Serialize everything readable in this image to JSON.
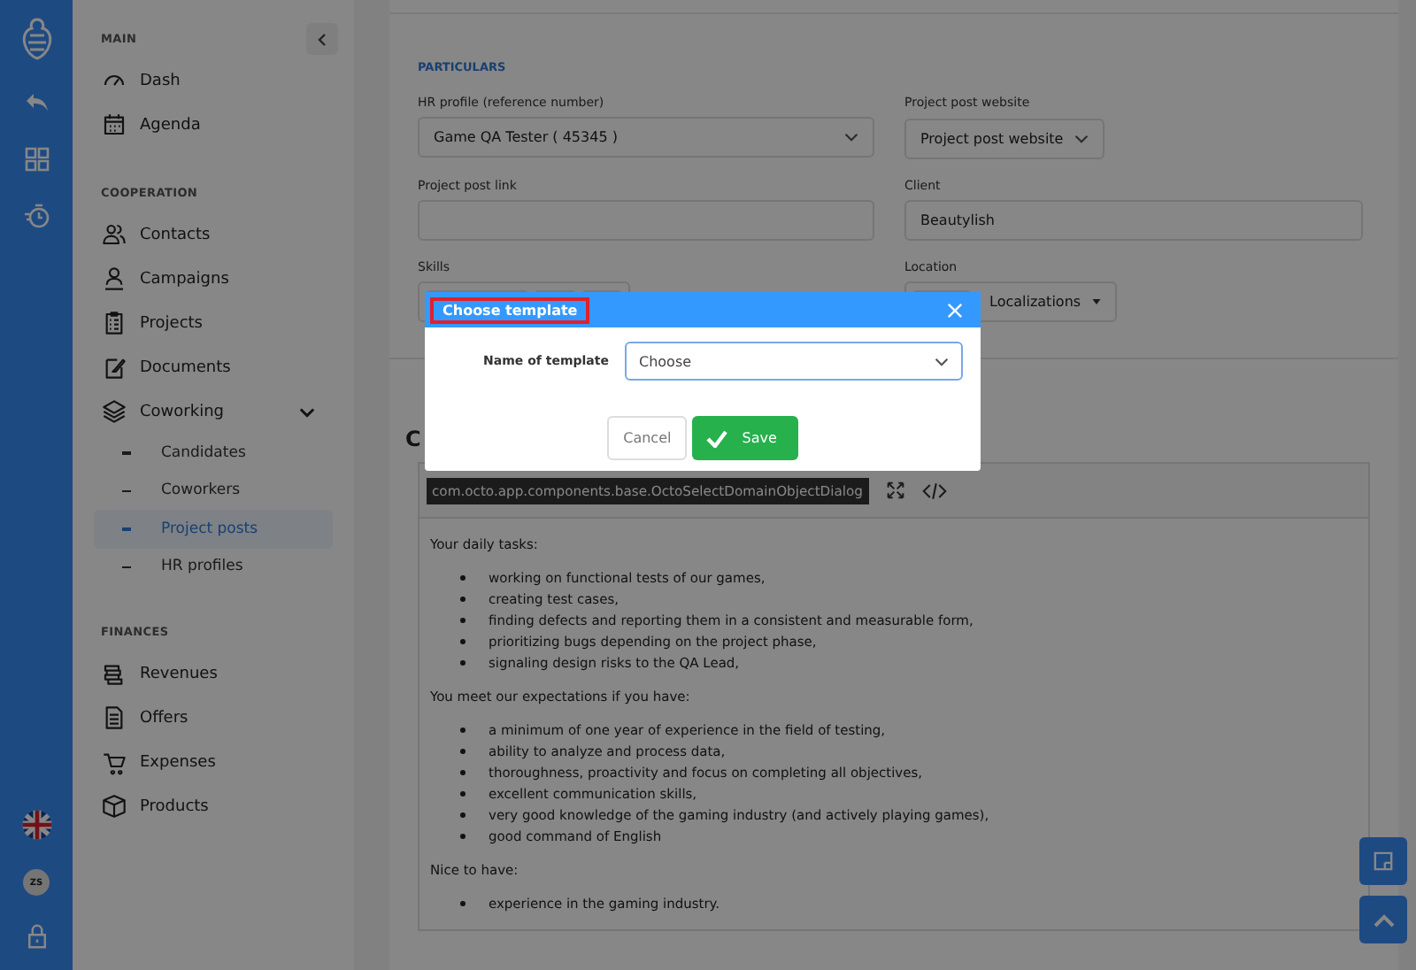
{
  "rail": {
    "avatar": "ZS"
  },
  "sidebar": {
    "sections": [
      {
        "title": "MAIN",
        "items": [
          {
            "label": "Dash",
            "selected": false
          },
          {
            "label": "Agenda",
            "selected": false
          }
        ]
      },
      {
        "title": "COOPERATION",
        "items": [
          {
            "label": "Contacts",
            "selected": false
          },
          {
            "label": "Campaigns",
            "selected": false
          },
          {
            "label": "Projects",
            "selected": false
          },
          {
            "label": "Documents",
            "selected": false
          },
          {
            "label": "Coworking",
            "selected": false,
            "expanded": true,
            "children": [
              {
                "label": "Candidates",
                "selected": false
              },
              {
                "label": "Coworkers",
                "selected": false
              },
              {
                "label": "Project posts",
                "selected": true
              },
              {
                "label": "HR profiles",
                "selected": false
              }
            ]
          }
        ]
      },
      {
        "title": "FINANCES",
        "items": [
          {
            "label": "Revenues",
            "selected": false
          },
          {
            "label": "Offers",
            "selected": false
          },
          {
            "label": "Expenses",
            "selected": false
          },
          {
            "label": "Products",
            "selected": false
          }
        ]
      }
    ]
  },
  "form": {
    "section_title": "PARTICULARS",
    "fields": [
      {
        "label": "HR profile (reference number)",
        "kind": "select",
        "value": "Game QA Tester ( 45345 )"
      },
      {
        "label": "Project post website",
        "kind": "dropdown",
        "value": "Project post website"
      },
      {
        "label": "Project post link",
        "kind": "text"
      },
      {
        "label": "Client",
        "kind": "text",
        "value": "Beautylish"
      },
      {
        "label": "Skills",
        "kind": "tags"
      },
      {
        "label": "Location",
        "kind": "tags_dropdown",
        "value": "Localizations"
      }
    ]
  },
  "editor": {
    "heading": "C",
    "tooltip": "com.octo.app.components.base.OctoSelectDomainObjectDialog",
    "content": [
      {
        "kind": "paragraph",
        "text": "Your daily tasks:"
      },
      {
        "kind": "list",
        "items": [
          "working on functional tests of our games,",
          "creating test cases,",
          "finding defects and reporting them in a consistent and measurable form,",
          "prioritizing bugs depending on the project phase,",
          "signaling design risks to the QA Lead,"
        ]
      },
      {
        "kind": "paragraph",
        "text": "You meet our expectations if you have:"
      },
      {
        "kind": "list",
        "items": [
          "a minimum of one year of experience in the field of testing,",
          "ability to analyze and process data,",
          "thoroughness, proactivity and focus on completing all objectives,",
          "excellent communication skills,",
          "very good knowledge of the gaming industry (and actively playing games),",
          "good command of English"
        ]
      },
      {
        "kind": "paragraph",
        "text": "Nice to have:"
      },
      {
        "kind": "list",
        "items": [
          "experience in the gaming industry."
        ]
      }
    ]
  },
  "dialog": {
    "title": "Choose template",
    "field_label": "Name of template",
    "value": "Choose",
    "buttons": [
      {
        "label": "Cancel",
        "kind": "secondary"
      },
      {
        "label": "Save",
        "kind": "primary"
      }
    ]
  }
}
